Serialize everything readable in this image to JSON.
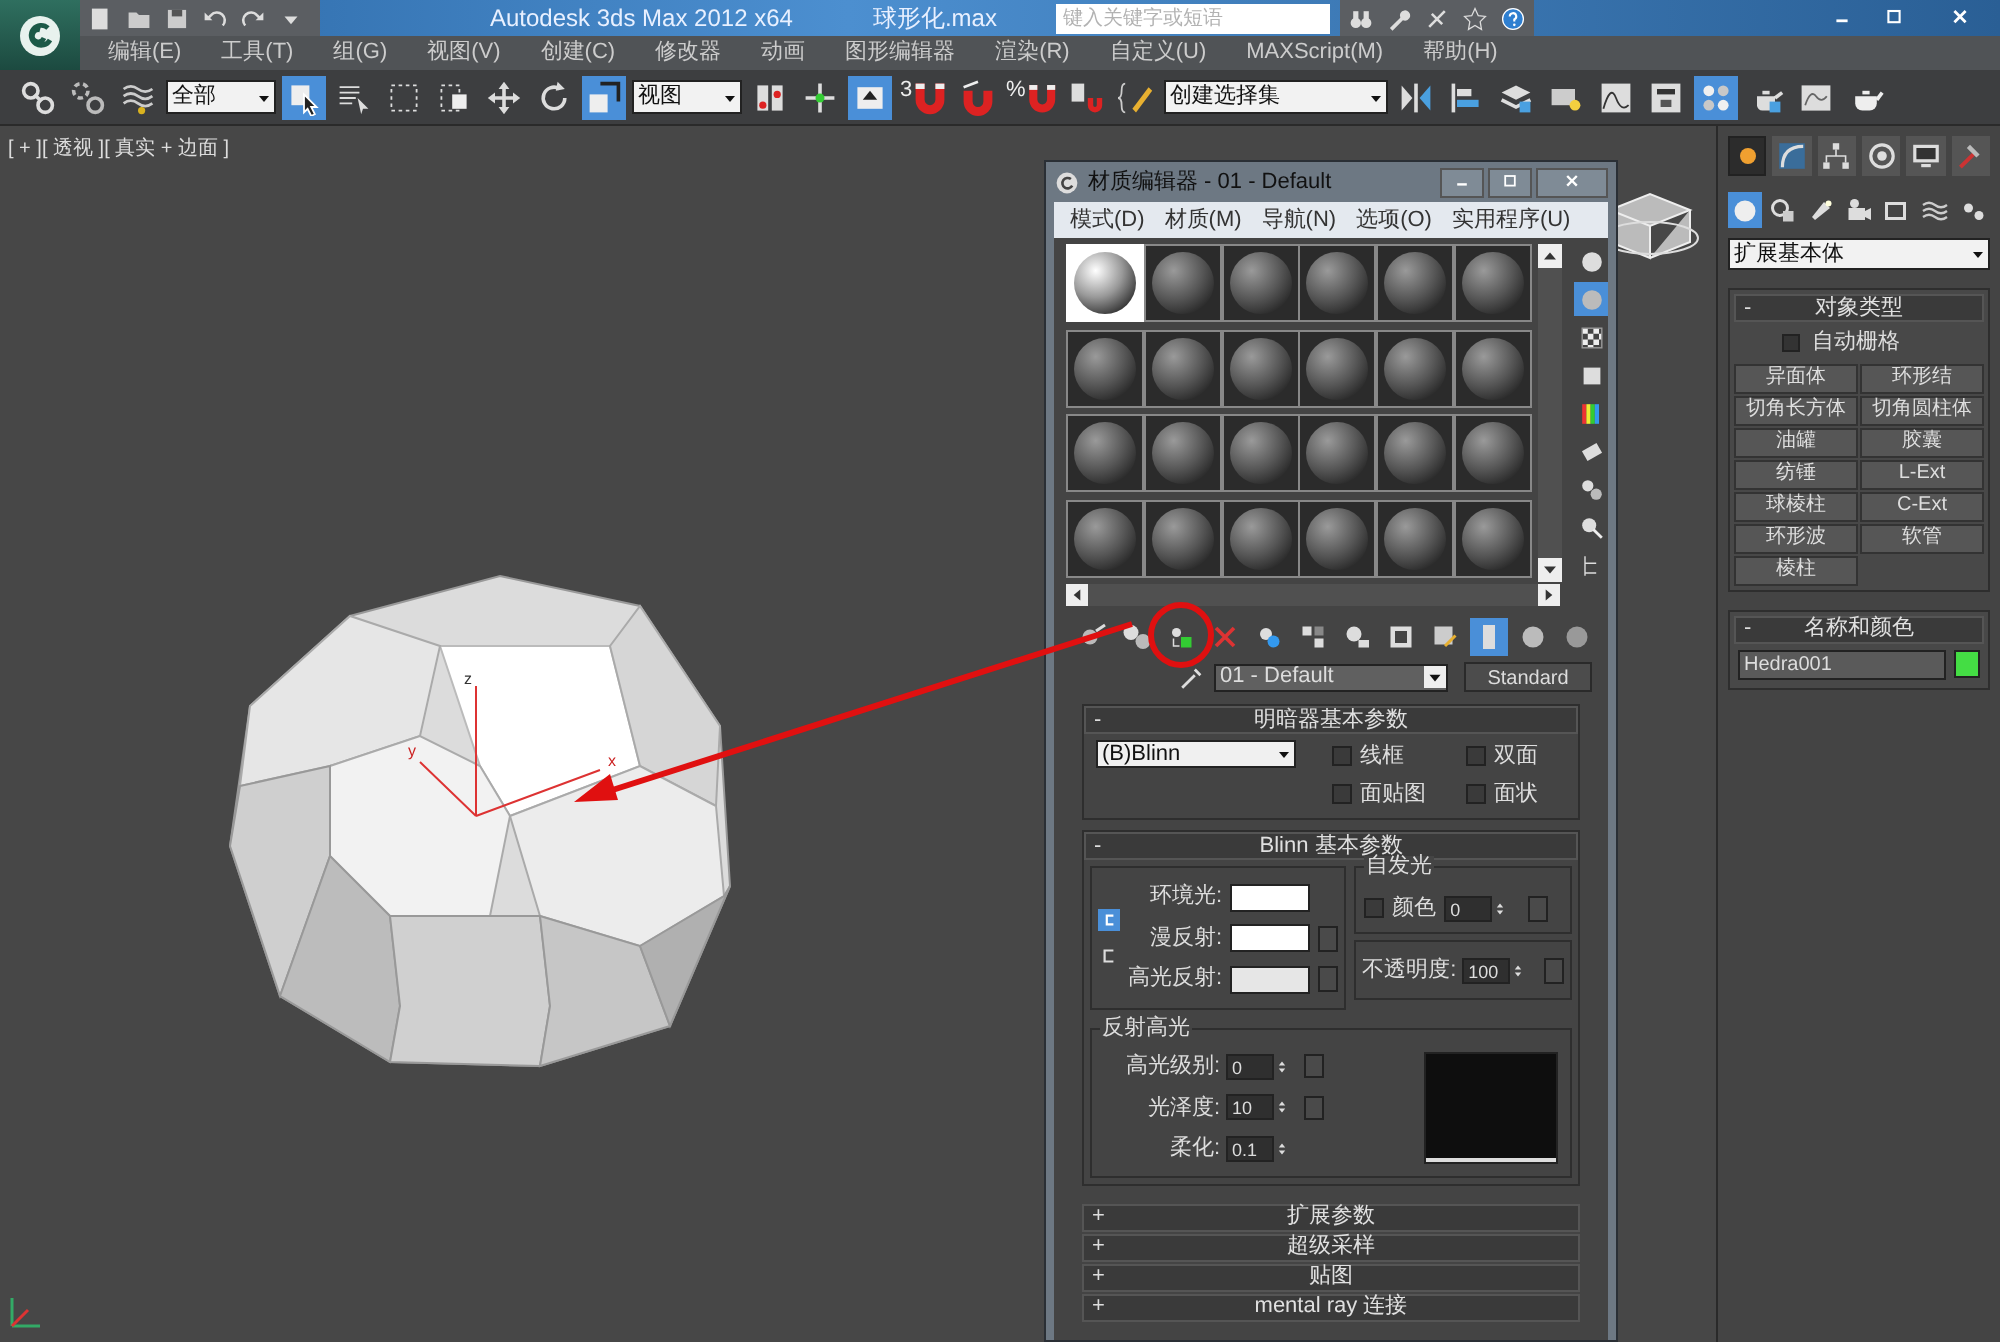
{
  "title_bar": {
    "app_title": "Autodesk 3ds Max  2012 x64",
    "file_name": "球形化.max",
    "search": {
      "placeholder": "键入关键字或短语"
    }
  },
  "menu_bar": [
    "编辑(E)",
    "工具(T)",
    "组(G)",
    "视图(V)",
    "创建(C)",
    "修改器",
    "动画",
    "图形编辑器",
    "渲染(R)",
    "自定义(U)",
    "MAXScript(M)",
    "帮助(H)"
  ],
  "main_toolbar": [
    {
      "kind": "button",
      "selected": false
    },
    {
      "kind": "button",
      "selected": false
    },
    {
      "kind": "button",
      "selected": false
    },
    {
      "kind": "dropdown",
      "value": "全部"
    },
    {
      "kind": "button",
      "selected": true
    },
    {
      "kind": "button",
      "selected": false
    },
    {
      "kind": "button",
      "selected": false
    },
    {
      "kind": "button",
      "selected": false
    },
    {
      "kind": "button",
      "selected": false
    },
    {
      "kind": "button",
      "selected": false
    },
    {
      "kind": "button",
      "selected": true
    },
    {
      "kind": "dropdown",
      "value": "视图"
    },
    {
      "kind": "button",
      "selected": false
    },
    {
      "kind": "button",
      "selected": false
    },
    {
      "kind": "button",
      "selected": true
    },
    {
      "kind": "snap",
      "label": "3",
      "selected": false
    },
    {
      "kind": "button",
      "selected": false
    },
    {
      "kind": "snap",
      "label": "%",
      "selected": false
    },
    {
      "kind": "button",
      "selected": false
    },
    {
      "kind": "button",
      "selected": false
    },
    {
      "kind": "dropdown",
      "value": "创建选择集"
    },
    {
      "kind": "button",
      "selected": false
    },
    {
      "kind": "button",
      "selected": false
    },
    {
      "kind": "button",
      "selected": false
    },
    {
      "kind": "button",
      "selected": false
    },
    {
      "kind": "button",
      "selected": false
    },
    {
      "kind": "button",
      "selected": false
    },
    {
      "kind": "button",
      "selected": true
    },
    {
      "kind": "button",
      "selected": false
    },
    {
      "kind": "button",
      "selected": false
    },
    {
      "kind": "button",
      "selected": false
    }
  ],
  "viewport": {
    "label": "[ + ][ 透视 ][ 真实 + 边面 ]",
    "gizmo_axes": [
      "z",
      "y",
      "x"
    ]
  },
  "material_editor": {
    "title": "材质编辑器 - 01 - Default",
    "menus": [
      "模式(D)",
      "材质(M)",
      "导航(N)",
      "选项(O)",
      "实用程序(U)"
    ],
    "slots": [
      {
        "selected": true
      },
      {
        "selected": false
      },
      {
        "selected": false
      },
      {
        "selected": false
      },
      {
        "selected": false
      },
      {
        "selected": false
      },
      {
        "selected": false
      },
      {
        "selected": false
      },
      {
        "selected": false
      },
      {
        "selected": false
      },
      {
        "selected": false
      },
      {
        "selected": false
      },
      {
        "selected": false
      },
      {
        "selected": false
      },
      {
        "selected": false
      },
      {
        "selected": false
      },
      {
        "selected": false
      },
      {
        "selected": false
      },
      {
        "selected": false
      },
      {
        "selected": false
      },
      {
        "selected": false
      },
      {
        "selected": false
      },
      {
        "selected": false
      },
      {
        "selected": false
      }
    ],
    "side_tools": [
      {
        "selected": false
      },
      {
        "selected": true
      },
      {
        "selected": false
      },
      {
        "selected": false
      },
      {
        "selected": false
      },
      {
        "selected": false
      },
      {
        "selected": false
      },
      {
        "selected": false
      },
      {
        "selected": false
      }
    ],
    "tools": [
      {
        "selected": false,
        "circled": false
      },
      {
        "selected": false,
        "circled": false
      },
      {
        "selected": false,
        "circled": true
      },
      {
        "selected": false,
        "circled": false
      },
      {
        "selected": false,
        "circled": false
      },
      {
        "selected": false,
        "circled": false
      },
      {
        "selected": false,
        "circled": false
      },
      {
        "selected": false,
        "circled": false
      },
      {
        "selected": false,
        "circled": false
      },
      {
        "selected": true,
        "circled": false
      },
      {
        "selected": false,
        "circled": false
      },
      {
        "selected": false,
        "circled": false
      }
    ],
    "material_name": "01 - Default",
    "material_type": "Standard",
    "shader_rollout": {
      "toggle": "-",
      "title": "明暗器基本参数",
      "shader": "(B)Blinn",
      "options": [
        {
          "label": "线框",
          "checked": false
        },
        {
          "label": "双面",
          "checked": false
        },
        {
          "label": "面贴图",
          "checked": false
        },
        {
          "label": "面状",
          "checked": false
        }
      ]
    },
    "blinn_rollout": {
      "toggle": "-",
      "title": "Blinn 基本参数",
      "colors": [
        {
          "label": "环境光:",
          "color": "#ffffff"
        },
        {
          "label": "漫反射:",
          "color": "#ffffff"
        },
        {
          "label": "高光反射:",
          "color": "#e6e6e6"
        }
      ],
      "self_illum": {
        "title": "自发光",
        "label": "颜色",
        "checked": false,
        "value": "0"
      },
      "opacity": {
        "label": "不透明度:",
        "value": "100"
      },
      "specular": {
        "title": "反射高光",
        "fields": [
          {
            "label": "高光级别:",
            "value": "0"
          },
          {
            "label": "光泽度:",
            "value": "10"
          },
          {
            "label": "柔化:",
            "value": "0.1"
          }
        ]
      }
    },
    "collapsed_rollouts": [
      {
        "toggle": "+",
        "title": "扩展参数"
      },
      {
        "toggle": "+",
        "title": "超级采样"
      },
      {
        "toggle": "+",
        "title": "贴图"
      },
      {
        "toggle": "+",
        "title": "mental ray 连接"
      }
    ]
  },
  "command_panel": {
    "tabs": [
      {
        "selected": true
      },
      {
        "selected": false
      },
      {
        "selected": false
      },
      {
        "selected": false
      },
      {
        "selected": false
      },
      {
        "selected": false
      }
    ],
    "categories": [
      {
        "selected": true
      },
      {
        "selected": false
      },
      {
        "selected": false
      },
      {
        "selected": false
      },
      {
        "selected": false
      },
      {
        "selected": false
      },
      {
        "selected": false
      }
    ],
    "category_dropdown": "扩展基本体",
    "object_type": {
      "toggle": "-",
      "title": "对象类型",
      "autogrid": {
        "label": "自动栅格",
        "checked": false
      },
      "buttons": [
        "异面体",
        "环形结",
        "切角长方体",
        "切角圆柱体",
        "油罐",
        "胶囊",
        "纺锤",
        "L-Ext",
        "球棱柱",
        "C-Ext",
        "环形波",
        "软管",
        "棱柱"
      ]
    },
    "name_and_color": {
      "toggle": "-",
      "title": "名称和颜色",
      "name": "Hedra001",
      "color": "#44dd44"
    }
  }
}
